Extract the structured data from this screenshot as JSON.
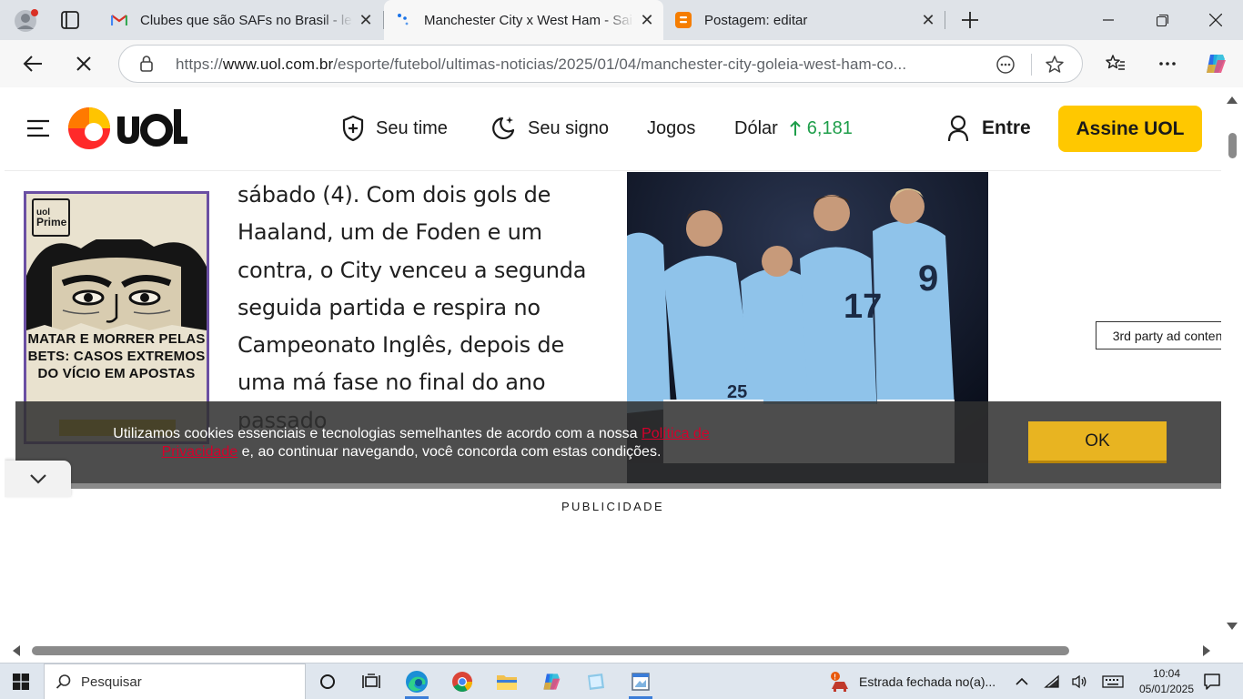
{
  "browser": {
    "tabs": [
      {
        "title": "Clubes que são SAFs no Brasil - le",
        "favicon": "gmail-icon",
        "active": false
      },
      {
        "title": "Manchester City x West Ham - Sai",
        "favicon": "loading-icon",
        "active": true
      },
      {
        "title": "Postagem: editar",
        "favicon": "blogger-icon",
        "active": false
      }
    ],
    "url_prefix": "https://",
    "url_host": "www.uol.com.br",
    "url_path": "/esporte/futebol/ultimas-noticias/2025/01/04/manchester-city-goleia-west-ham-co..."
  },
  "header": {
    "nav": {
      "seu_time": "Seu time",
      "seu_signo": "Seu signo",
      "jogos": "Jogos",
      "dolar_label": "Dólar",
      "dolar_value": "6,181"
    },
    "login": "Entre",
    "subscribe": "Assine UOL",
    "brand_color": "#ffc800"
  },
  "ad": {
    "badge_line1": "uol",
    "badge_line2": "Prime",
    "headline": "MATAR E MORRER PELAS BETS: CASOS EXTREMOS DO VÍCIO EM APOSTAS"
  },
  "article": {
    "lines": [
      "sábado (4). Com dois gols de",
      "Haaland, um de Foden e um",
      "contra, o City venceu a segunda",
      "seguida partida e respira no",
      "Campeonato Inglês, depois de",
      "uma má fase no final do ano",
      "passado"
    ]
  },
  "publicidade": "PUBLICIDADE",
  "cookie": {
    "text_before": "Utilizamos cookies essenciais e tecnologias semelhantes de acordo com a nossa ",
    "link": "Política de Privacidade",
    "text_after": " e, ao continuar navegando, você concorda com estas condições.",
    "ok": "OK"
  },
  "tooltip": "3rd party ad content",
  "taskbar": {
    "search_placeholder": "Pesquisar",
    "weather": "Estrada fechada no(a)...",
    "time": "10:04",
    "date": "05/01/2025"
  }
}
